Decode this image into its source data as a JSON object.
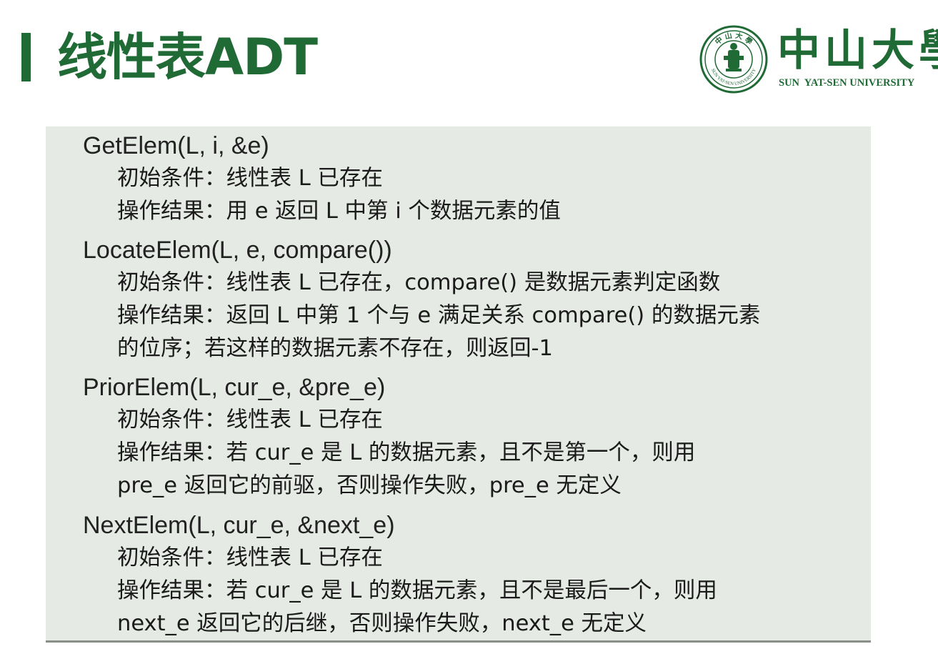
{
  "header": {
    "title": "线性表ADT",
    "logo": {
      "chinese_name": "中山大學",
      "english_name": "SUN  YAT-SEN UNIVERSITY",
      "seal_chars": "中山大學",
      "seal_ring_text": "SUN YAT-SEN UNIVERSITY"
    }
  },
  "operations": [
    {
      "signature": "GetElem(L, i, &e)",
      "lines": [
        "初始条件：线性表 L 已存在",
        "操作结果：用 e 返回 L 中第 i 个数据元素的值"
      ]
    },
    {
      "signature": "LocateElem(L, e, compare())",
      "lines": [
        "初始条件：线性表 L 已存在，compare() 是数据元素判定函数",
        "操作结果：返回 L 中第 1 个与 e 满足关系 compare() 的数据元素",
        "的位序；若这样的数据元素不存在，则返回-1"
      ]
    },
    {
      "signature": "PriorElem(L, cur_e, &pre_e)",
      "lines": [
        "初始条件：线性表 L 已存在",
        "操作结果：若 cur_e 是 L 的数据元素，且不是第一个，则用",
        "pre_e 返回它的前驱，否则操作失败，pre_e 无定义"
      ]
    },
    {
      "signature": "NextElem(L, cur_e, &next_e)",
      "lines": [
        "初始条件：线性表 L 已存在",
        "操作结果：若 cur_e 是 L 的数据元素，且不是最后一个，则用",
        "next_e 返回它的后继，否则操作失败，next_e 无定义"
      ]
    }
  ],
  "colors": {
    "accent": "#1f6a35",
    "panel_background": "#e6eae5"
  }
}
